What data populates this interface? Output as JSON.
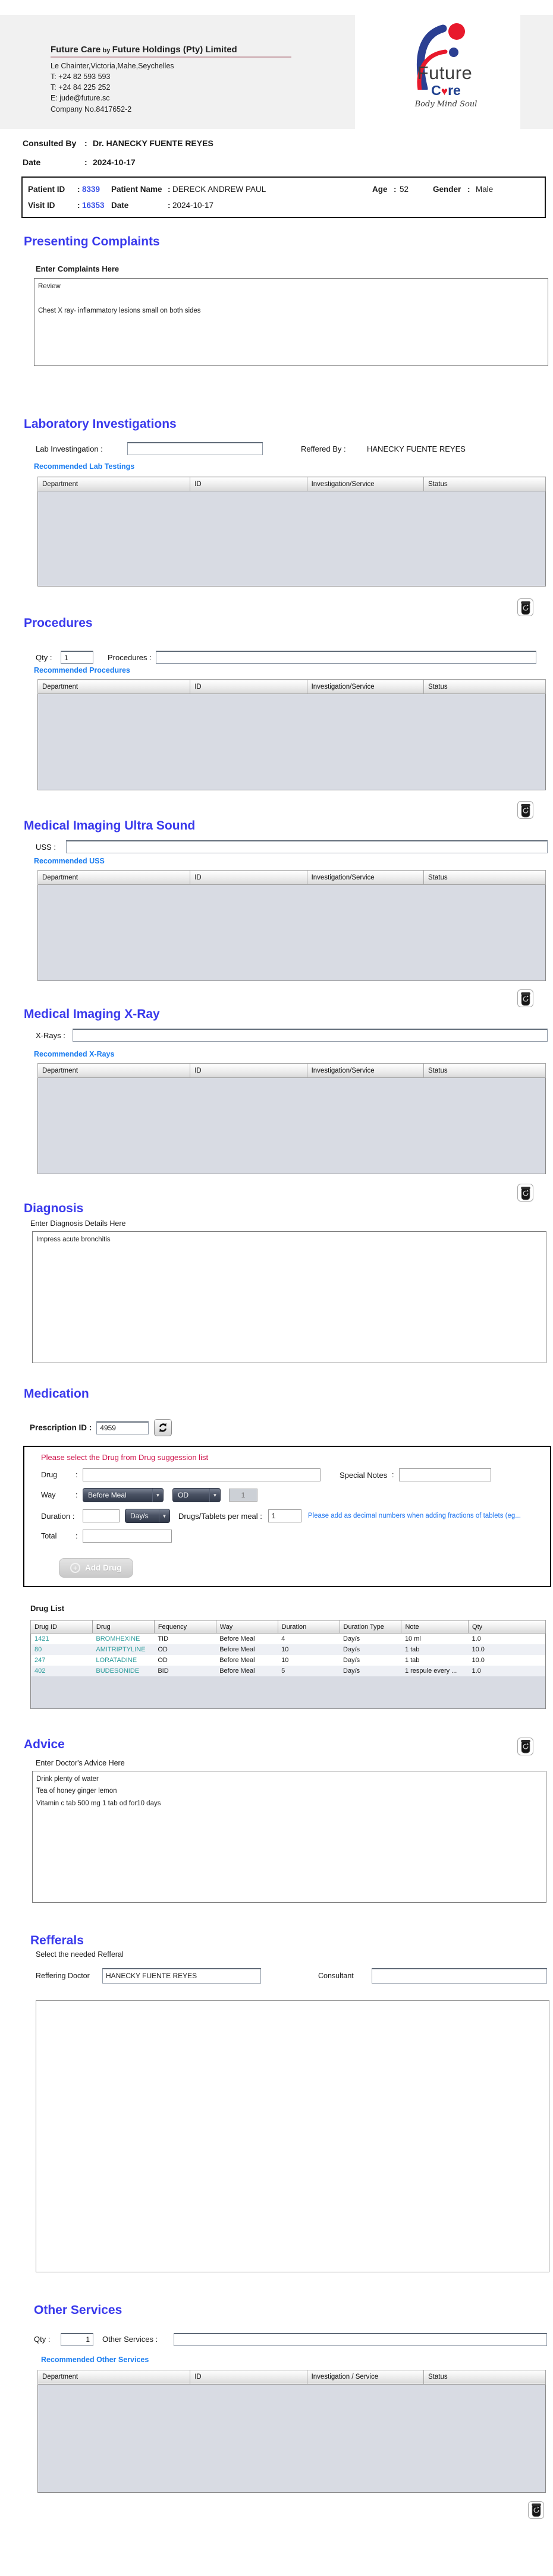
{
  "ui": {
    "colon": ":",
    "icons": {
      "chevron_down": "▼",
      "plus": "+",
      "heart": "♥"
    }
  },
  "colors": {
    "heading_blue": "#3A3AEC",
    "link_blue": "#1B7DF0",
    "alert_red": "#CE1049",
    "drug_teal": "#2B9B9B"
  },
  "header": {
    "company_name_primary": "Future Care",
    "company_name_by": "by",
    "company_name_secondary": "Future Holdings (Pty) Limited",
    "address": "Le Chainter,Victoria,Mahe,Seychelles",
    "phone1": "T: +24  82 593 593",
    "phone2": "T: +24  84 225 252",
    "email": "E: jude@future.sc",
    "company_no": "Company No.8417652-2",
    "logo": {
      "future": "Future",
      "care_c": "C",
      "care_re": "re",
      "tagline": "Body Mind Soul"
    }
  },
  "consultation": {
    "consulted_by_label": "Consulted By",
    "consulted_by_value": "Dr.  HANECKY FUENTE REYES",
    "date_label": "Date",
    "date_value": "2024-10-17"
  },
  "patient": {
    "patient_id_label": "Patient ID",
    "patient_id": "8339",
    "patient_name_label": "Patient Name",
    "patient_name": "DERECK ANDREW PAUL",
    "age_label": "Age",
    "age": "52",
    "gender_label": "Gender",
    "gender": "Male",
    "visit_id_label": "Visit ID",
    "visit_id": "16353",
    "visit_date_label": "Date",
    "visit_date": "2024-10-17"
  },
  "invest_headers": [
    "Department",
    "ID",
    "Investigation/Service",
    "Status"
  ],
  "other_headers": [
    "Department",
    "ID",
    "Investigation / Service",
    "Status"
  ],
  "complaints": {
    "title": "Presenting Complaints",
    "label": "Enter Complaints Here",
    "text": "Review\n\nChest X ray- inflammatory lesions small on both sides"
  },
  "lab": {
    "title": "Laboratory  Investigations",
    "input_label": "Lab Investingation :",
    "input_value": "",
    "referred_by_label": "Reffered By :",
    "referred_by_value": "HANECKY FUENTE REYES",
    "link": "Recommended Lab Testings"
  },
  "procedures": {
    "title": "Procedures",
    "qty_label": "Qty :",
    "qty_value": "1",
    "input_label": "Procedures :",
    "input_value": "",
    "link": "Recommended Procedures"
  },
  "uss": {
    "title": "Medical Imaging Ultra Sound",
    "input_label": "USS :",
    "input_value": "",
    "link": "Recommended USS"
  },
  "xray": {
    "title": "Medical Imaging X-Ray",
    "input_label": "X-Rays :",
    "input_value": "",
    "link": "Recommended X-Rays"
  },
  "diagnosis": {
    "title": "Diagnosis",
    "label": "Enter Diagnosis Details Here",
    "text": "Impress acute bronchitis"
  },
  "medication": {
    "title": "Medication",
    "prescription_id_label": "Prescription ID :",
    "prescription_id": "4959",
    "alert": "Please select the Drug from Drug suggession list",
    "drug_label": "Drug",
    "drug_value": "",
    "special_notes_label": "Special Notes",
    "special_notes_value": "",
    "way_label": "Way",
    "way_value": "Before Meal",
    "freq_value": "OD",
    "way_qty": "1",
    "duration_label": "Duration :",
    "duration_value": "",
    "duration_type": "Day/s",
    "per_meal_label": "Drugs/Tablets per meal :",
    "per_meal_value": "1",
    "fraction_note": "Please add as decimal numbers when adding fractions of tablets (eg...",
    "total_label": "Total",
    "total_value": "",
    "add_drug_label": "Add Drug",
    "drug_list_label": "Drug List",
    "drug_table": {
      "headers": [
        "Drug ID",
        "Drug",
        "Fequency",
        "Way",
        "Duration",
        "Duration Type",
        "Note",
        "Qty"
      ],
      "rows": [
        [
          "1421",
          "BROMHEXINE",
          "TID",
          "Before Meal",
          "4",
          "Day/s",
          "10 ml",
          "1.0"
        ],
        [
          "80",
          "AMITRIPTYLINE",
          "OD",
          "Before Meal",
          "10",
          "Day/s",
          "1 tab",
          "10.0"
        ],
        [
          "247",
          "LORATADINE",
          "OD",
          "Before Meal",
          "10",
          "Day/s",
          "1 tab",
          "10.0"
        ],
        [
          "402",
          "BUDESONIDE",
          "BID",
          "Before Meal",
          "5",
          "Day/s",
          "1 respule every ...",
          "1.0"
        ]
      ]
    }
  },
  "advice": {
    "title": "Advice",
    "label": "Enter Doctor's Advice Here",
    "text": "Drink plenty of water\nTea of honey ginger lemon\nVitamin c tab 500 mg 1 tab od for10 days"
  },
  "referrals": {
    "title": "Refferals",
    "label": "Select the needed Refferal",
    "doctor_label": "Reffering Doctor",
    "doctor_value": "HANECKY FUENTE REYES",
    "consultant_label": "Consultant",
    "consultant_value": ""
  },
  "other_services": {
    "title": "Other Services",
    "qty_label": "Qty :",
    "qty_value": "1",
    "input_label": "Other Services :",
    "input_value": "",
    "link": "Recommended Other Services"
  }
}
